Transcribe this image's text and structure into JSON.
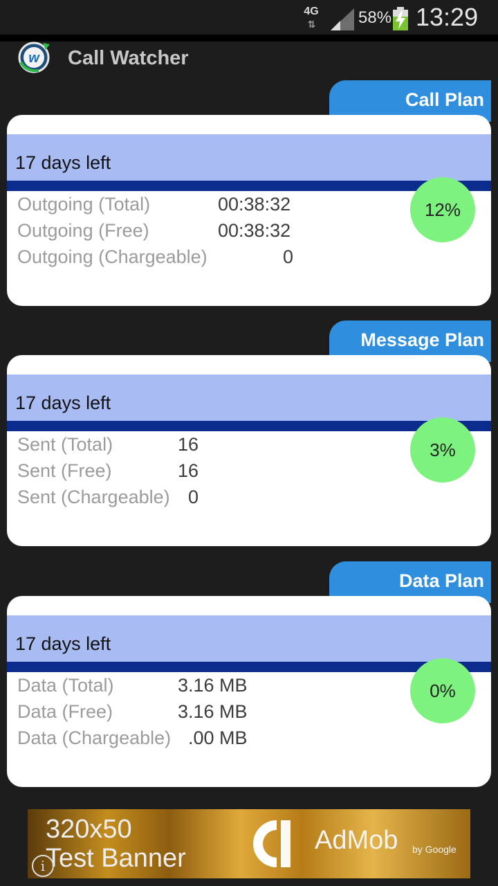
{
  "status_bar": {
    "network": "4G",
    "battery_percent": "58%",
    "time": "13:29",
    "icons": [
      "network-4g-icon",
      "signal-icon",
      "battery-charging-icon"
    ]
  },
  "app": {
    "title": "Call Watcher",
    "logo_icon": "call-watcher-logo-icon"
  },
  "plans": [
    {
      "tab": "Call Plan",
      "days_left": "17 days left",
      "percent": "12%",
      "rows": [
        {
          "label": "Outgoing (Total)",
          "value": "00:38:32"
        },
        {
          "label": "Outgoing (Free)",
          "value": "00:38:32"
        },
        {
          "label": "Outgoing (Chargeable)",
          "value": "0"
        }
      ]
    },
    {
      "tab": "Message Plan",
      "days_left": "17 days left",
      "percent": "3%",
      "rows": [
        {
          "label": "Sent (Total)",
          "value": "16"
        },
        {
          "label": "Sent (Free)",
          "value": "16"
        },
        {
          "label": "Sent (Chargeable)",
          "value": "0"
        }
      ]
    },
    {
      "tab": "Data Plan",
      "days_left": "17 days left",
      "percent": "0%",
      "rows": [
        {
          "label": "Data (Total)",
          "value": "3.16 MB"
        },
        {
          "label": "Data (Free)",
          "value": "3.16 MB"
        },
        {
          "label": "Data (Chargeable)",
          "value": ".00 MB"
        }
      ]
    }
  ],
  "ad": {
    "line1": "320x50",
    "line2": "Test Banner",
    "brand": "AdMob",
    "by": "by Google",
    "info": "i"
  },
  "colors": {
    "background": "#1d1d1d",
    "tab_blue": "#2f8fde",
    "band": "#a8bcf3",
    "band_line": "#0b2c8c",
    "percent_circle": "#7df27f"
  }
}
